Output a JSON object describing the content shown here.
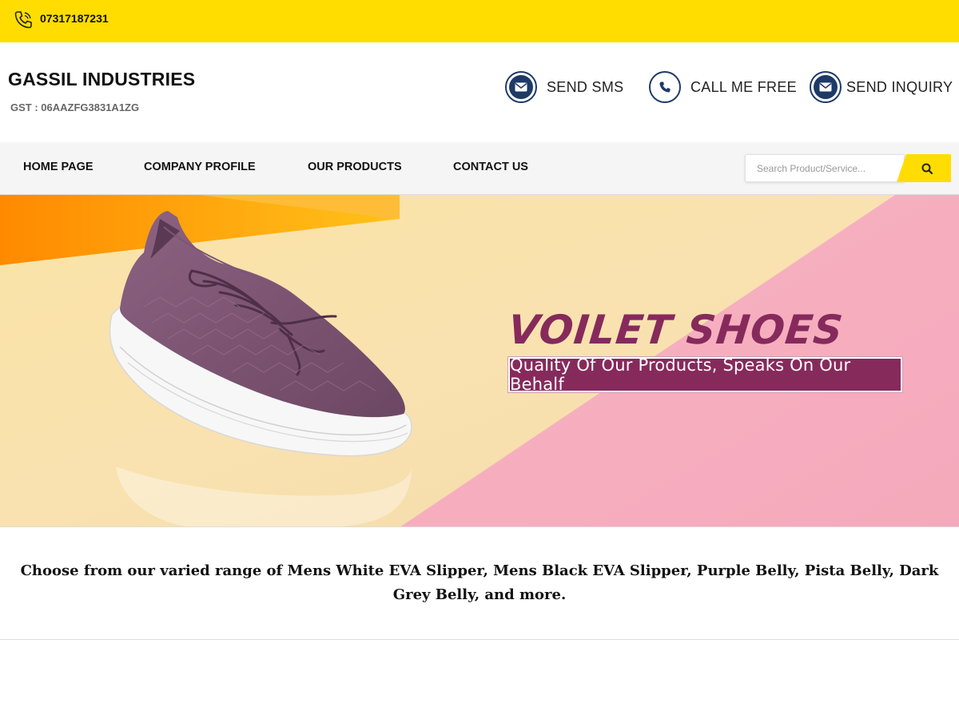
{
  "topbar": {
    "phone": "07317187231",
    "phone_icon": "phone-icon",
    "bg_color": "#ffdd00"
  },
  "header": {
    "company_name": "GASSIL INDUSTRIES",
    "gst": "GST : 06AAZFG3831A1ZG",
    "actions": [
      {
        "label": "SEND SMS",
        "icon": "envelope-icon"
      },
      {
        "label": "CALL ME FREE",
        "icon": "phone-icon"
      },
      {
        "label": "SEND INQUIRY",
        "icon": "envelope-icon"
      }
    ],
    "accent_color": "#1e3a66"
  },
  "nav": {
    "items": [
      {
        "label": "HOME PAGE"
      },
      {
        "label": "COMPANY PROFILE"
      },
      {
        "label": "OUR PRODUCTS"
      },
      {
        "label": "CONTACT US"
      }
    ],
    "search": {
      "placeholder": "Search Product/Service...",
      "button_icon": "search-icon"
    }
  },
  "banner": {
    "title": "VOILET SHOES",
    "tagline": "Quality Of Our Products, Speaks On Our Behalf",
    "title_color": "#862a5c"
  },
  "intro": {
    "text": "Choose from our varied range of Mens White EVA Slipper, Mens Black EVA Slipper, Purple Belly, Pista Belly, Dark Grey Belly, and more."
  }
}
